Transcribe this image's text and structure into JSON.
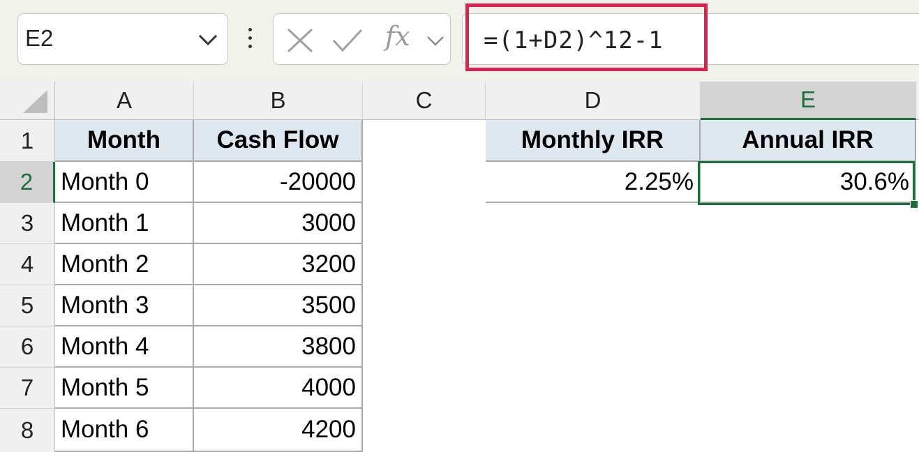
{
  "formula_bar": {
    "name_box": "E2",
    "formula": "=(1+D2)^12-1",
    "icons": [
      "chevron-down-icon",
      "more-options-icon",
      "cancel-icon",
      "enter-icon",
      "fx-icon",
      "chevron-down-icon"
    ],
    "fx_label": "fx"
  },
  "grid": {
    "columns": [
      "A",
      "B",
      "C",
      "D",
      "E"
    ],
    "rows": [
      "1",
      "2",
      "3",
      "4",
      "5",
      "6",
      "7",
      "8"
    ],
    "active_column": "E",
    "active_row": "2",
    "table": {
      "headers": [
        "Month",
        "Cash Flow"
      ],
      "rows": [
        [
          "Month 0",
          "-20000"
        ],
        [
          "Month 1",
          "3000"
        ],
        [
          "Month 2",
          "3200"
        ],
        [
          "Month 3",
          "3500"
        ],
        [
          "Month 4",
          "3800"
        ],
        [
          "Month 5",
          "4000"
        ],
        [
          "Month 6",
          "4200"
        ]
      ]
    },
    "irr": {
      "monthly_header": "Monthly IRR",
      "annual_header": "Annual IRR",
      "monthly_value": "2.25%",
      "annual_value": "30.6%"
    }
  },
  "colors": {
    "selection_green": "#1e6b3c",
    "highlight_red": "#e0204f",
    "header_fill": "#dde8f1"
  }
}
